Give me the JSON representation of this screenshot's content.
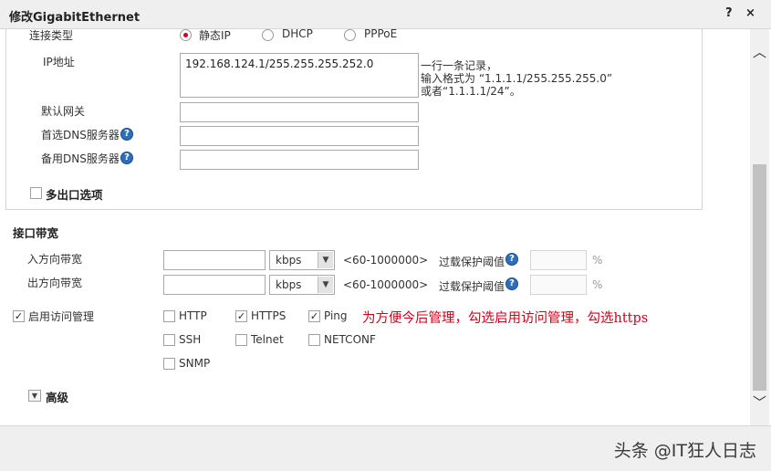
{
  "window": {
    "title": "修改GigabitEthernet",
    "help_glyph": "?",
    "close_glyph": "×"
  },
  "connection_type": {
    "label": "连接类型",
    "options": [
      "静态IP",
      "DHCP",
      "PPPoE"
    ],
    "selected": "静态IP"
  },
  "ip": {
    "label": "IP地址",
    "value": "192.168.124.1/255.255.255.252.0",
    "hint_line1": "一行一条记录，",
    "hint_line2": "输入格式为 “1.1.1.1/255.255.255.0”",
    "hint_line3": "或者“1.1.1.1/24”。"
  },
  "gateway": {
    "label": "默认网关",
    "value": ""
  },
  "dns_primary": {
    "label": "首选DNS服务器",
    "value": ""
  },
  "dns_secondary": {
    "label": "备用DNS服务器",
    "value": ""
  },
  "multi_exit": {
    "label": "多出口选项",
    "checked": false
  },
  "bandwidth": {
    "section_title": "接口带宽",
    "inbound": {
      "label": "入方向带宽",
      "value": "",
      "unit": "kbps",
      "range": "<60-1000000>",
      "overload_label": "过载保护阈值",
      "overload_value": "",
      "percent": "%"
    },
    "outbound": {
      "label": "出方向带宽",
      "value": "",
      "unit": "kbps",
      "range": "<60-1000000>",
      "overload_label": "过载保护阈值",
      "overload_value": "",
      "percent": "%"
    }
  },
  "access_mgmt": {
    "label": "启用访问管理",
    "checked": true,
    "protocols": [
      {
        "name": "HTTP",
        "checked": false
      },
      {
        "name": "HTTPS",
        "checked": true
      },
      {
        "name": "Ping",
        "checked": true
      },
      {
        "name": "SSH",
        "checked": false
      },
      {
        "name": "Telnet",
        "checked": false
      },
      {
        "name": "NETCONF",
        "checked": false
      },
      {
        "name": "SNMP",
        "checked": false
      }
    ],
    "note": "为方便今后管理，勾选启用访问管理，勾选https",
    "note_color": "#d0021b"
  },
  "advanced": {
    "label": "高级",
    "glyph": "▼"
  },
  "check_glyph": "✓",
  "scrollbar": {
    "up_glyph": "︿",
    "down_glyph": "﹀"
  },
  "watermark": "头条 @IT狂人日志"
}
